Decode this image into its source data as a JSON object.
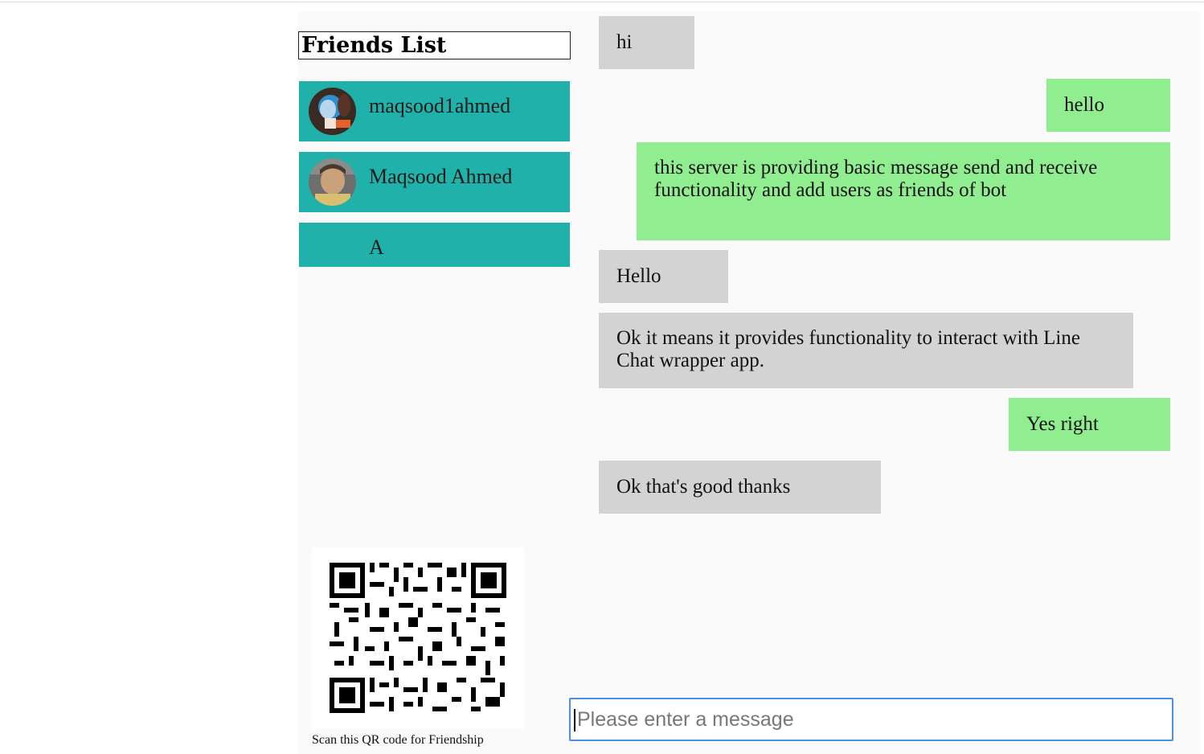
{
  "sidebar": {
    "title": "Friends List",
    "friends": [
      {
        "name": "maqsood1ahmed",
        "avatar": "avatar-photo-1"
      },
      {
        "name": "Maqsood Ahmed",
        "avatar": "avatar-photo-2"
      },
      {
        "name": "A",
        "avatar": "avatar-blank"
      }
    ],
    "qr_caption": "Scan this QR code for Friendship"
  },
  "chat": {
    "messages": [
      {
        "direction": "received",
        "text": "hi"
      },
      {
        "direction": "sent",
        "text": "hello"
      },
      {
        "direction": "sent",
        "text": "this server is providing basic message send and receive functionality and add users as friends of bot"
      },
      {
        "direction": "received",
        "text": "Hello"
      },
      {
        "direction": "received",
        "text": "Ok it means it provides functionality to interact with Line Chat wrapper app."
      },
      {
        "direction": "sent",
        "text": "Yes right"
      },
      {
        "direction": "received",
        "text": "Ok that's good thanks"
      }
    ],
    "input": {
      "placeholder": "Please enter a message",
      "value": ""
    }
  },
  "colors": {
    "friend_bg": "#20b2aa",
    "sent_bg": "#90ee90",
    "received_bg": "#d3d3d3",
    "input_border": "#4a90e2"
  }
}
